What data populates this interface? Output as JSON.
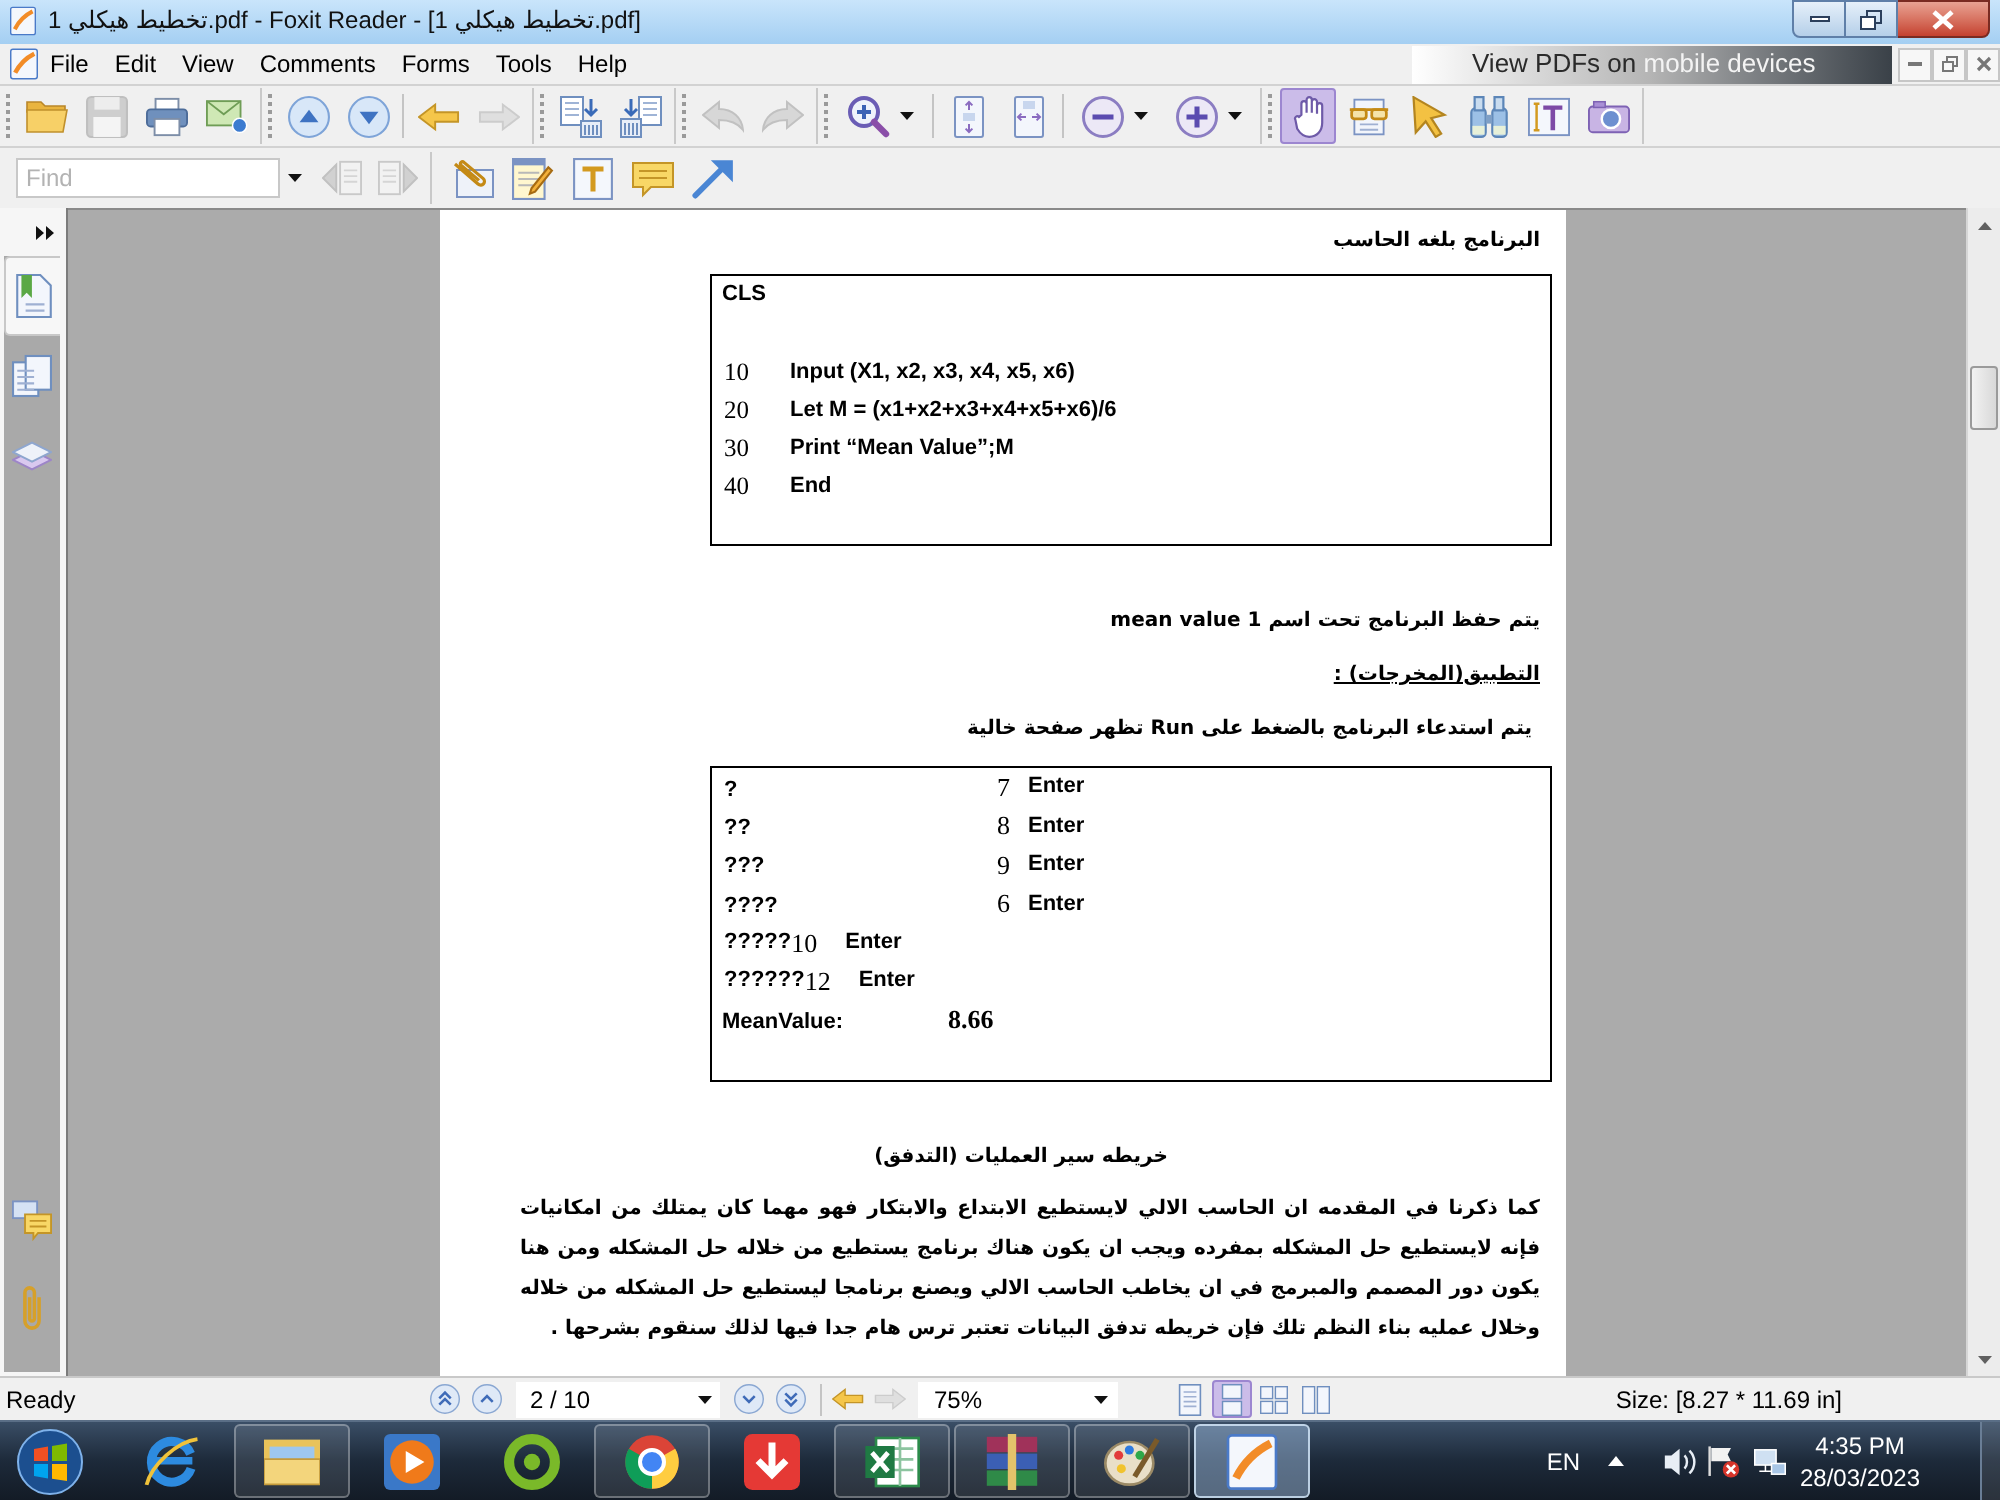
{
  "window": {
    "title": "تخطيط هيكلي 1.pdf - Foxit Reader - [تخطيط هيكلي 1.pdf]"
  },
  "menu_bar": {
    "items": [
      "File",
      "Edit",
      "View",
      "Comments",
      "Forms",
      "Tools",
      "Help"
    ],
    "promo": {
      "text": "View PDFs on",
      "accent_text": "mobile devices"
    }
  },
  "toolbar": {
    "bands": [
      {
        "sections": [
          {
            "buttons": [
              {
                "kind": "open",
                "disabled": false
              },
              {
                "kind": "save",
                "disabled": true
              },
              {
                "kind": "print",
                "disabled": false
              },
              {
                "kind": "email",
                "disabled": false
              }
            ]
          }
        ]
      },
      {
        "sections": [
          {
            "buttons": [
              {
                "kind": "page_up",
                "disabled": false
              },
              {
                "kind": "page_down",
                "disabled": false
              }
            ]
          },
          {
            "buttons": [
              {
                "kind": "back",
                "disabled": false
              },
              {
                "kind": "forward",
                "disabled": true
              }
            ]
          }
        ]
      },
      {
        "sections": [
          {
            "buttons": [
              {
                "kind": "extract_pages",
                "disabled": false
              },
              {
                "kind": "insert_pages",
                "disabled": false
              }
            ]
          }
        ]
      },
      {
        "sections": [
          {
            "buttons": [
              {
                "kind": "undo",
                "disabled": true
              },
              {
                "kind": "redo",
                "disabled": true
              }
            ]
          }
        ]
      },
      {
        "sections": [
          {
            "buttons": [
              {
                "kind": "zoom_menu",
                "disabled": false
              }
            ]
          },
          {
            "buttons": [
              {
                "kind": "fit_page",
                "disabled": false
              },
              {
                "kind": "fit_width",
                "disabled": false
              }
            ]
          },
          {
            "buttons": [
              {
                "kind": "zoom_out",
                "disabled": false
              },
              {
                "kind": "zoom_in",
                "disabled": false
              }
            ]
          }
        ]
      }
    ],
    "tools": [
      {
        "kind": "hand",
        "selected": true
      },
      {
        "kind": "reading",
        "selected": false
      },
      {
        "kind": "select",
        "selected": false
      },
      {
        "kind": "find",
        "selected": false
      },
      {
        "kind": "text_select",
        "selected": false
      },
      {
        "kind": "snapshot",
        "selected": false
      }
    ]
  },
  "annotation_bar": {
    "find_field": {
      "placeholder": "Find"
    },
    "find_buttons": [
      {
        "kind": "find_prev",
        "disabled": true
      },
      {
        "kind": "find_next",
        "disabled": true
      }
    ],
    "tools": [
      {
        "kind": "attach",
        "selected": false
      },
      {
        "kind": "note",
        "selected": false
      },
      {
        "kind": "typewriter",
        "selected": false
      },
      {
        "kind": "comment",
        "selected": false
      },
      {
        "kind": "arrow",
        "selected": false
      }
    ]
  },
  "sidebar": {
    "tabs": [
      {
        "kind": "bookmarks",
        "selected": true
      },
      {
        "kind": "pages",
        "selected": false
      },
      {
        "kind": "layers",
        "selected": false
      }
    ],
    "bottom_tabs": [
      {
        "kind": "comments",
        "selected": false
      },
      {
        "kind": "attachments",
        "selected": false
      }
    ]
  },
  "page": {
    "heading": "البرنامج بلغه الحاسب",
    "code_box": {
      "header": "CLS",
      "lines": [
        {
          "number": "10",
          "statement": "Input (X1, x2, x3, x4, x5, x6)"
        },
        {
          "number": "20",
          "statement": "Let M = (x1+x2+x3+x4+x5+x6)/6"
        },
        {
          "number": "30",
          "statement": "Print “Mean Value”;M"
        },
        {
          "number": "40",
          "statement": "End"
        }
      ]
    },
    "save_note": "يتم حفظ البرنامج تحت اسم mean value 1",
    "output_heading": "التطبيق(المخرجات) :",
    "run_note": "يتم استدعاء البرنامج بالضغط على Run تظهر صفحة خالية",
    "output_box": {
      "rows": [
        {
          "kind": "aligned",
          "prompt": "?",
          "value": "7",
          "key": "Enter"
        },
        {
          "kind": "aligned",
          "prompt": "??",
          "value": "8",
          "key": "Enter"
        },
        {
          "kind": "aligned",
          "prompt": "???",
          "value": "9",
          "key": "Enter"
        },
        {
          "kind": "aligned",
          "prompt": "????",
          "value": "6",
          "key": "Enter"
        },
        {
          "kind": "inline",
          "prompt": "?????",
          "value": "10",
          "key": "Enter"
        },
        {
          "kind": "inline",
          "prompt": "??????",
          "value": "12",
          "key": "Enter"
        }
      ],
      "result": {
        "label": "MeanValue:",
        "value": "8.66"
      }
    },
    "section_title": "خريطه سير العمليات (التدفق)",
    "paragraph": "كما ذكرنا في المقدمه ان الحاسب الالي لايستطيع الابتداع والابتكار فهو مهما كان يمتلك من امكانيات فإنه لايستطيع حل المشكله بمفرده ويجب ان يكون هناك برنامج يستطيع من خلاله حل المشكله ومن هنا يكون دور المصمم والمبرمج في ان يخاطب الحاسب الالي ويصنع برنامجا ليستطيع حل المشكله من خلاله وخلال عمليه بناء النظم تلك فإن خريطه تدفق البيانات تعتبر ترس هام جدا فيها لذلك سنقوم بشرحها ."
  },
  "status_bar": {
    "status": "Ready",
    "page_field": "2 / 10",
    "history_buttons": [
      {
        "kind": "back",
        "disabled": false
      },
      {
        "kind": "forward",
        "disabled": true
      }
    ],
    "zoom_field": "75%",
    "view_modes": [
      {
        "kind": "single",
        "selected": false
      },
      {
        "kind": "continuous",
        "selected": true
      },
      {
        "kind": "facing",
        "selected": false
      },
      {
        "kind": "continuous_facing",
        "selected": false
      }
    ],
    "size": "Size: [8.27 * 11.69 in]"
  },
  "taskbar": {
    "apps": [
      {
        "kind": "e_browser",
        "running": false,
        "selected": false
      },
      {
        "kind": "file_manager",
        "running": true,
        "selected": false
      },
      {
        "kind": "media_player",
        "running": false,
        "selected": false
      },
      {
        "kind": "cleaner",
        "running": false,
        "selected": false
      },
      {
        "kind": "ring_browser",
        "running": true,
        "selected": false
      },
      {
        "kind": "downloader",
        "running": false,
        "selected": false
      },
      {
        "kind": "spreadsheet",
        "running": true,
        "selected": false
      },
      {
        "kind": "archiver",
        "running": true,
        "selected": false
      },
      {
        "kind": "paint",
        "running": true,
        "selected": false
      },
      {
        "kind": "pdf_reader",
        "running": true,
        "selected": true
      }
    ],
    "language": "EN",
    "time": "4:35 PM",
    "date": "28/03/2023"
  }
}
